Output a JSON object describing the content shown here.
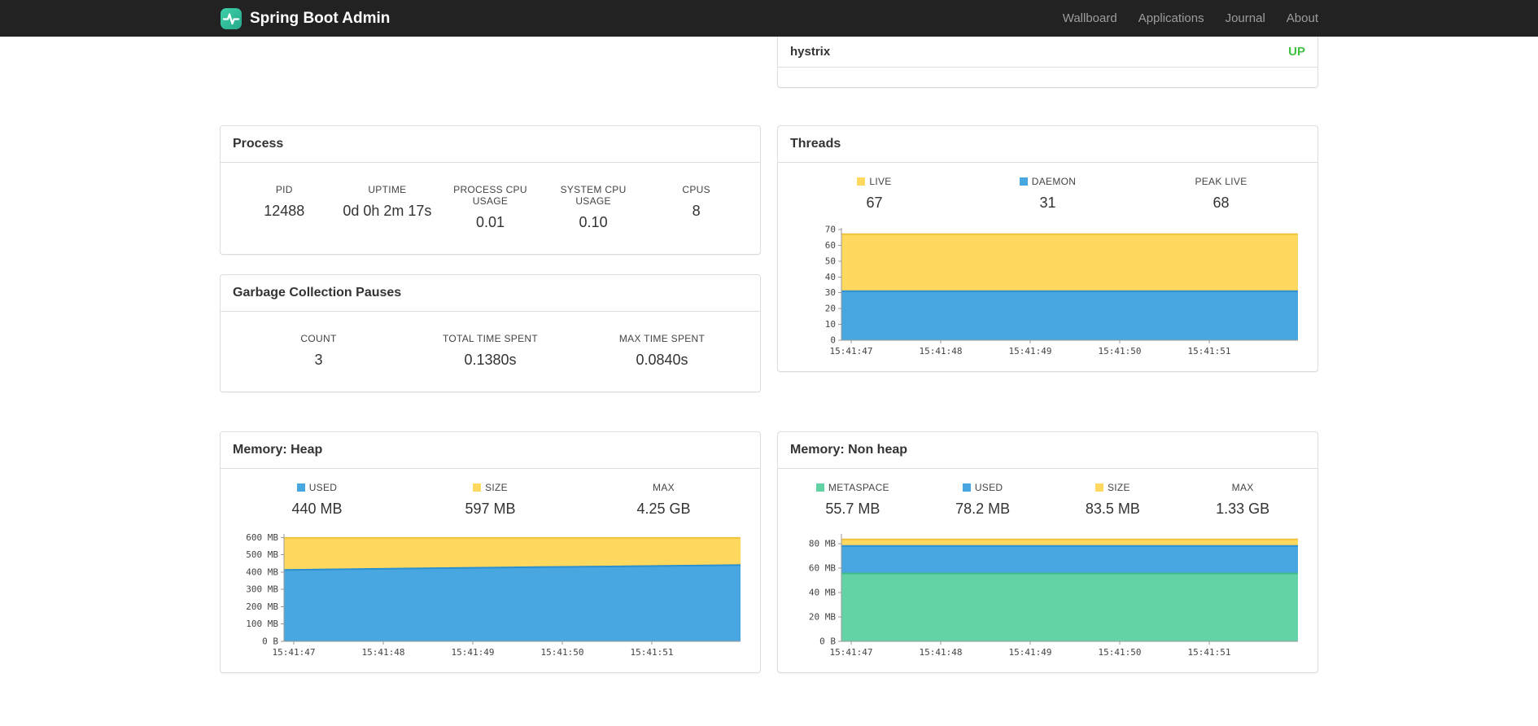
{
  "colors": {
    "navbar_bg": "#222222",
    "status_up": "#42c142",
    "panel_border": "#dddddd",
    "series_yellow": "#FFD95F",
    "series_blue": "#48A7E0",
    "series_green": "#63D3A6",
    "logo_teal": "#31BFA0"
  },
  "navbar": {
    "brand": "Spring Boot Admin",
    "items": [
      {
        "label": "Wallboard"
      },
      {
        "label": "Applications"
      },
      {
        "label": "Journal"
      },
      {
        "label": "About"
      }
    ]
  },
  "application_status": {
    "name": "hystrix",
    "status": "UP"
  },
  "process": {
    "title": "Process",
    "stats": [
      {
        "label": "PID",
        "value": "12488",
        "swatch": null
      },
      {
        "label": "UPTIME",
        "value": "0d 0h 2m 17s",
        "swatch": null
      },
      {
        "label": "PROCESS CPU USAGE",
        "value": "0.01",
        "swatch": null
      },
      {
        "label": "SYSTEM CPU USAGE",
        "value": "0.10",
        "swatch": null
      },
      {
        "label": "CPUS",
        "value": "8",
        "swatch": null
      }
    ]
  },
  "gc": {
    "title": "Garbage Collection Pauses",
    "stats": [
      {
        "label": "COUNT",
        "value": "3",
        "swatch": null
      },
      {
        "label": "TOTAL TIME SPENT",
        "value": "0.1380s",
        "swatch": null
      },
      {
        "label": "MAX TIME SPENT",
        "value": "0.0840s",
        "swatch": null
      }
    ]
  },
  "threads": {
    "title": "Threads",
    "stats": [
      {
        "label": "LIVE",
        "value": "67",
        "swatch": "#FFD95F"
      },
      {
        "label": "DAEMON",
        "value": "31",
        "swatch": "#48A7E0"
      },
      {
        "label": "PEAK LIVE",
        "value": "68",
        "swatch": null
      }
    ],
    "chart_data": {
      "type": "area",
      "stacked": true,
      "grid": false,
      "legend_position": "top",
      "x": [
        "15:41:47",
        "15:41:48",
        "15:41:49",
        "15:41:50",
        "15:41:51"
      ],
      "ylim": [
        0,
        71
      ],
      "yticks": [
        {
          "v": 0,
          "label": "0"
        },
        {
          "v": 10,
          "label": "10"
        },
        {
          "v": 20,
          "label": "20"
        },
        {
          "v": 30,
          "label": "30"
        },
        {
          "v": 40,
          "label": "40"
        },
        {
          "v": 50,
          "label": "50"
        },
        {
          "v": 60,
          "label": "60"
        },
        {
          "v": 70,
          "label": "70"
        }
      ],
      "series": [
        {
          "name": "LIVE",
          "color": "#FFD95F",
          "stroke": "#F0C33C",
          "values": [
            67,
            67,
            67,
            67,
            67
          ]
        },
        {
          "name": "DAEMON",
          "color": "#48A7E0",
          "stroke": "#2B8FD0",
          "values": [
            31,
            31,
            31,
            31,
            31
          ]
        }
      ]
    }
  },
  "memory_heap": {
    "title": "Memory: Heap",
    "stats": [
      {
        "label": "USED",
        "value": "440 MB",
        "swatch": "#48A7E0"
      },
      {
        "label": "SIZE",
        "value": "597 MB",
        "swatch": "#FFD95F"
      },
      {
        "label": "MAX",
        "value": "4.25 GB",
        "swatch": null
      }
    ],
    "chart_data": {
      "type": "area",
      "stacked": true,
      "grid": false,
      "legend_position": "top",
      "x": [
        "15:41:47",
        "15:41:48",
        "15:41:49",
        "15:41:50",
        "15:41:51"
      ],
      "ylim": [
        0,
        620
      ],
      "yticks": [
        {
          "v": 0,
          "label": "0 B"
        },
        {
          "v": 100,
          "label": "100 MB"
        },
        {
          "v": 200,
          "label": "200 MB"
        },
        {
          "v": 300,
          "label": "300 MB"
        },
        {
          "v": 400,
          "label": "400 MB"
        },
        {
          "v": 500,
          "label": "500 MB"
        },
        {
          "v": 600,
          "label": "600 MB"
        }
      ],
      "series": [
        {
          "name": "SIZE",
          "color": "#FFD95F",
          "stroke": "#F0C33C",
          "values": [
            597,
            597,
            597,
            597,
            597
          ]
        },
        {
          "name": "USED",
          "color": "#48A7E0",
          "stroke": "#2B8FD0",
          "values": [
            412,
            420,
            427,
            433,
            440
          ]
        }
      ]
    }
  },
  "memory_nonheap": {
    "title": "Memory: Non heap",
    "stats": [
      {
        "label": "METASPACE",
        "value": "55.7 MB",
        "swatch": "#63D3A6"
      },
      {
        "label": "USED",
        "value": "78.2 MB",
        "swatch": "#48A7E0"
      },
      {
        "label": "SIZE",
        "value": "83.5 MB",
        "swatch": "#FFD95F"
      },
      {
        "label": "MAX",
        "value": "1.33 GB",
        "swatch": null
      }
    ],
    "chart_data": {
      "type": "area",
      "stacked": true,
      "grid": false,
      "legend_position": "top",
      "x": [
        "15:41:47",
        "15:41:48",
        "15:41:49",
        "15:41:50",
        "15:41:51"
      ],
      "ylim": [
        0,
        88
      ],
      "yticks": [
        {
          "v": 0,
          "label": "0 B"
        },
        {
          "v": 20,
          "label": "20 MB"
        },
        {
          "v": 40,
          "label": "40 MB"
        },
        {
          "v": 60,
          "label": "60 MB"
        },
        {
          "v": 80,
          "label": "80 MB"
        }
      ],
      "series": [
        {
          "name": "SIZE",
          "color": "#FFD95F",
          "stroke": "#F0C33C",
          "values": [
            83.5,
            83.5,
            83.5,
            83.5,
            83.5
          ]
        },
        {
          "name": "USED",
          "color": "#48A7E0",
          "stroke": "#2B8FD0",
          "values": [
            78.2,
            78.2,
            78.2,
            78.2,
            78.2
          ]
        },
        {
          "name": "METASPACE",
          "color": "#63D3A6",
          "stroke": "#3CBD8B",
          "values": [
            55.7,
            55.7,
            55.7,
            55.7,
            55.7
          ]
        }
      ]
    }
  }
}
